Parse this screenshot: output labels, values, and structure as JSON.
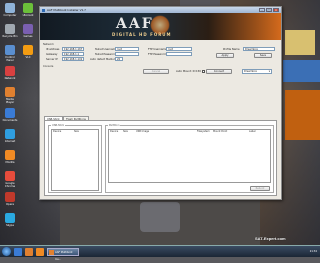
{
  "desktop": {
    "icons": [
      {
        "label": "Computer"
      },
      {
        "label": "Recycle Bin"
      },
      {
        "label": "Control Panel"
      },
      {
        "label": "Network"
      },
      {
        "label": "Media Player"
      },
      {
        "label": "Documents"
      },
      {
        "label": "Internet"
      },
      {
        "label": "Mozilla"
      },
      {
        "label": "Google Chrome"
      },
      {
        "label": "Opera"
      },
      {
        "label": "Skype"
      },
      {
        "label": "Utorrent"
      },
      {
        "label": "Games"
      },
      {
        "label": "VLC"
      }
    ],
    "watermark": "SAT-Expert.com",
    "colors": {
      "accent": "#d46a1c",
      "window_bg": "#ece9e2"
    }
  },
  "window": {
    "title": "AAF Multiboot Installer V1.7",
    "banner_logo": "AAF",
    "banner_sub": "DIGITAL HD FORUM",
    "network_label": "Network",
    "fields": {
      "ip": {
        "label": "IP-address",
        "value": "192.168.1.167"
      },
      "gateway": {
        "label": "Gateway",
        "value": "192.168.1.1"
      },
      "server": {
        "label": "Server IP",
        "value": "192.168.1.102"
      },
      "telnet_user": {
        "label": "Telnet Username",
        "value": "root"
      },
      "telnet_pass": {
        "label": "Telnet Password",
        "value": ""
      },
      "auto_detect": {
        "label": "Auto detect Medium",
        "value": "20"
      },
      "ftp_user": {
        "label": "FTP Username",
        "value": "root"
      },
      "ftp_pass": {
        "label": "FTP Password",
        "value": ""
      },
      "profile_name": {
        "label": "Profile Name",
        "value": "Dreambox"
      }
    },
    "buttons": {
      "apply": "Apply",
      "save": "Save",
      "cancel": "Cancel",
      "connect": "Connect",
      "reboot": "Reboot"
    },
    "auto_mount": {
      "label": "Auto Mount: ID",
      "value": "150"
    },
    "output_label": "Console",
    "dropdown": {
      "selected": "Dreambox"
    },
    "tabs": [
      "USB-Stick",
      "Flash Partitions"
    ],
    "groups": {
      "left": {
        "title": "USB-Stick",
        "columns": [
          "Device",
          "Size"
        ]
      },
      "right": {
        "title": "Partition",
        "columns": [
          "Device",
          "Size",
          "USB Image",
          "Filesystem",
          "Mount Point",
          "Label"
        ]
      }
    }
  },
  "taskbar": {
    "task_label": "AAF Multiboot Ins...",
    "tray_time": "21:34"
  }
}
